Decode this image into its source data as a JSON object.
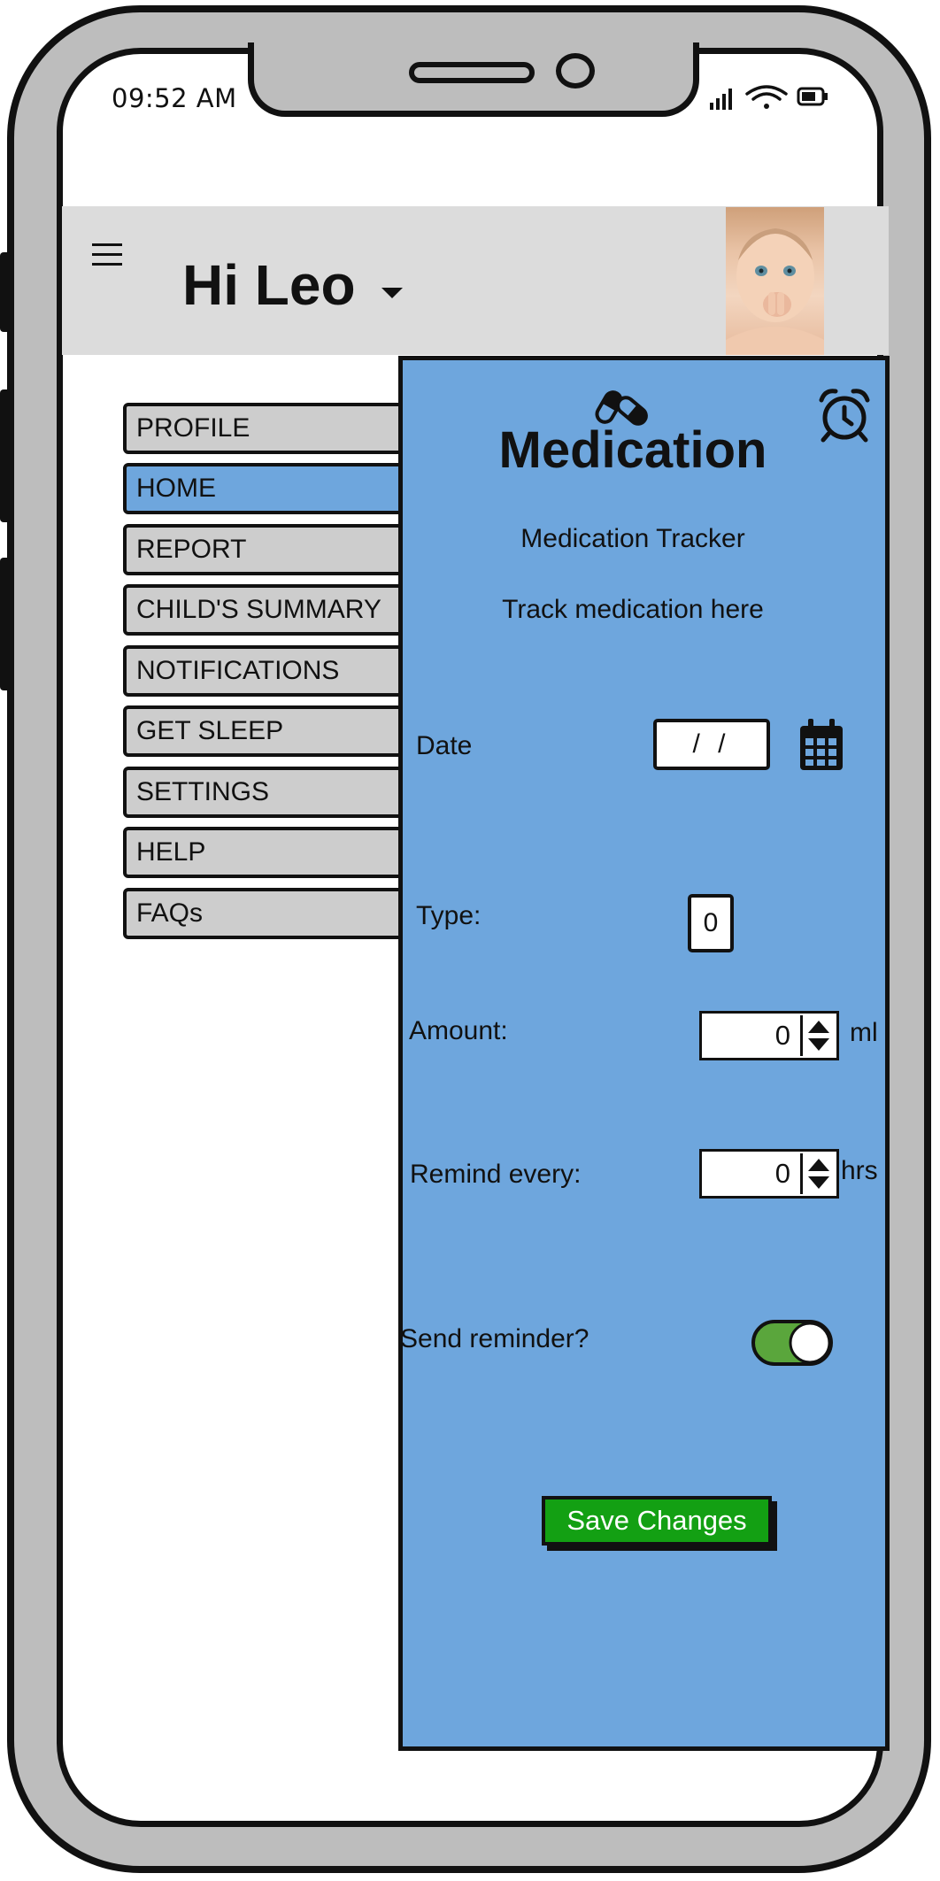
{
  "status_bar": {
    "time": "09:52 AM",
    "icons": [
      "signal-icon",
      "wifi-icon",
      "battery-icon"
    ]
  },
  "header": {
    "menu_icon": "hamburger-menu-icon",
    "greeting": "Hi Leo",
    "dropdown_icon": "caret-down-icon",
    "avatar": "baby-photo-avatar",
    "background_color": "#dcdcdc"
  },
  "side_menu": {
    "items": [
      {
        "label": "PROFILE"
      },
      {
        "label": "HOME",
        "active": true
      },
      {
        "label": "REPORT"
      },
      {
        "label": "CHILD'S SUMMARY"
      },
      {
        "label": "NOTIFICATIONS"
      },
      {
        "label": "GET SLEEP"
      },
      {
        "label": "SETTINGS"
      },
      {
        "label": "HELP"
      },
      {
        "label": "FAQs"
      }
    ],
    "active_color": "#6ea6dd",
    "inactive_color": "#cdcdcd"
  },
  "panel": {
    "title": "Medication",
    "title_icon": "pills-icon",
    "corner_icon": "alarm-clock-icon",
    "subtitle": "Medication Tracker",
    "tagline": "Track medication here",
    "background_color": "#6ea6dd",
    "fields": {
      "date": {
        "label": "Date",
        "value": "/ /",
        "icon": "calendar-icon"
      },
      "type": {
        "label": "Type:",
        "value": "0"
      },
      "amount": {
        "label": "Amount:",
        "value": "0",
        "unit": "ml"
      },
      "remind_every": {
        "label": "Remind every:",
        "value": "0",
        "unit": "hrs"
      },
      "send_reminder": {
        "label": "Send reminder?",
        "on": true,
        "on_color": "#5aa63c"
      }
    },
    "save_button": {
      "label": "Save Changes",
      "color": "#13a013"
    }
  }
}
